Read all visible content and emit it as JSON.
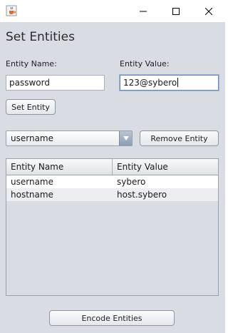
{
  "window": {
    "icon": "java-cup-icon"
  },
  "form": {
    "heading": "Set Entities",
    "name_label": "Entity Name:",
    "value_label": "Entity Value:",
    "name_value": "password",
    "value_value": "123@sybero",
    "set_button": "Set Entity"
  },
  "entity_select": {
    "selected": "username"
  },
  "remove_button": "Remove Entity",
  "table": {
    "columns": [
      "Entity Name",
      "Entity Value"
    ],
    "rows": [
      [
        "username",
        "sybero"
      ],
      [
        "hostname",
        "host.sybero"
      ]
    ]
  },
  "encode_button": "Encode Entities",
  "colors": {
    "window_bg": "#d9dce2",
    "focus_border": "#6b86b7",
    "combo_arrow": "#8f9db3"
  }
}
